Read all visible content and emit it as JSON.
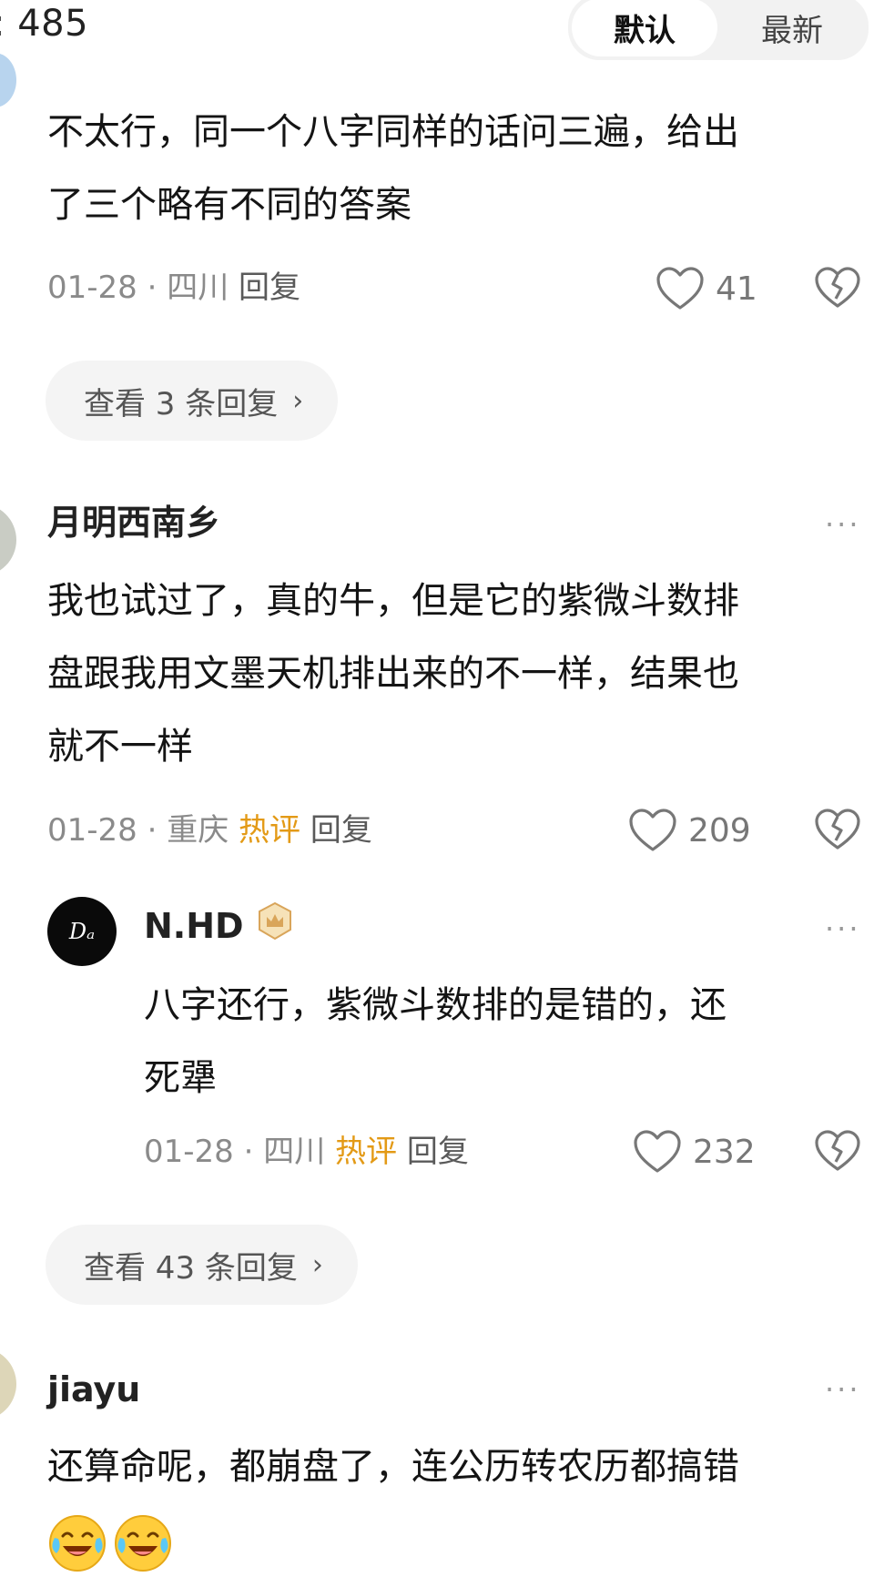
{
  "header": {
    "comment_count": "485",
    "sort_default": "默认",
    "sort_latest": "最新"
  },
  "comments": [
    {
      "text_lines": [
        "不太行，同一个八字同样的话问三遍，给出",
        "了三个略有不同的答案"
      ],
      "date": "01-28",
      "location": "四川",
      "reply_label": "回复",
      "likes": "41",
      "view_replies": "查看 3 条回复"
    },
    {
      "username": "月明西南乡",
      "text_lines": [
        "我也试过了，真的牛，但是它的紫微斗数排",
        "盘跟我用文墨天机排出来的不一样，结果也",
        "就不一样"
      ],
      "date": "01-28",
      "location": "重庆",
      "hot_label": "热评",
      "reply_label": "回复",
      "likes": "209",
      "reply": {
        "avatar_text": "Dₐ",
        "username": "N.HD",
        "text_lines": [
          "八字还行，紫微斗数排的是错的，还",
          "死犟"
        ],
        "date": "01-28",
        "location": "四川",
        "hot_label": "热评",
        "reply_label": "回复",
        "likes": "232"
      },
      "view_replies": "查看 43 条回复"
    },
    {
      "username": "jiayu",
      "text_lines": [
        "还算命呢，都崩盘了，连公历转农历都搞错"
      ],
      "emoji_icons": [
        "laughing-crying-emoji",
        "laughing-crying-emoji"
      ]
    }
  ],
  "menu_glyph": "···",
  "separator": "·",
  "chevron": "›"
}
